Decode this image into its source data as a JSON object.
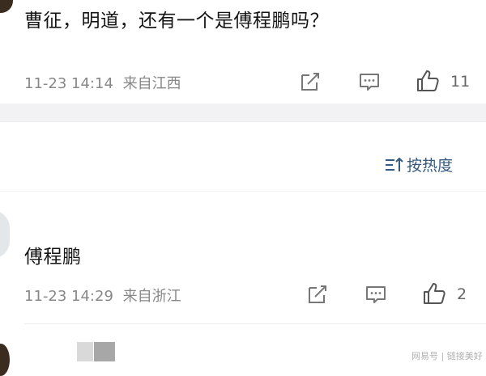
{
  "comment1": {
    "text": "曹征，明道，还有一个是傅程鹏吗？",
    "time": "11-23 14:14",
    "location": "来自江西",
    "likes": "11"
  },
  "sort": {
    "label": "按热度",
    "icon": "sort-icon"
  },
  "comment2": {
    "text": "傅程鹏",
    "time": "11-23 14:29",
    "location": "来自浙江",
    "likes": "2"
  },
  "watermark": {
    "text": "网易号 | 链接美好"
  },
  "colors": {
    "accent": "#35597f",
    "meta": "#888888",
    "separator": "#f2f2f4"
  },
  "icons": [
    "share-icon",
    "comment-icon",
    "thumbs-up-icon",
    "sort-icon"
  ]
}
